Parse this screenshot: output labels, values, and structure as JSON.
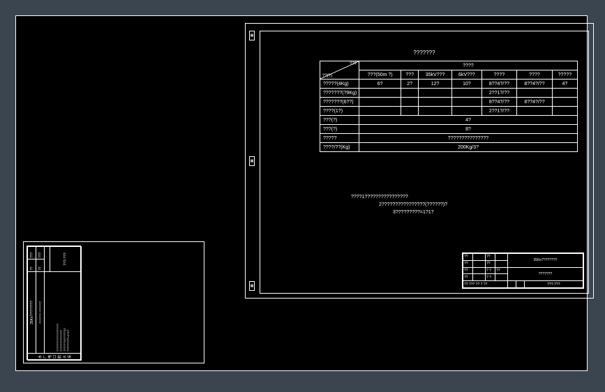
{
  "title_top": "???????",
  "diag_header": {
    "top": "???",
    "bottom": "??(?)"
  },
  "super_header": "????",
  "col_headers": [
    "???(50m ?)",
    "???",
    "35kV???",
    "6kV???",
    "????",
    "????",
    "?????"
  ],
  "rows": [
    {
      "label": "?????(4Kg)",
      "cells": [
        "6?",
        "2?",
        "12?",
        "10?",
        "8??4?/??",
        "8??4?/??",
        "4?"
      ]
    },
    {
      "label": "???????(?9Kg)",
      "cells": [
        "",
        "",
        "",
        "",
        "2??1?/??",
        "",
        ""
      ]
    },
    {
      "label": "???????(6??)",
      "cells": [
        "",
        "",
        "",
        "",
        "8??4?/??",
        "8??4?/??",
        ""
      ]
    },
    {
      "label": "????(1?)",
      "cells": [
        "",
        "",
        "",
        "",
        "2??1?/??",
        "",
        ""
      ]
    }
  ],
  "merged_rows": [
    {
      "label": "???(?)",
      "value": "4?"
    },
    {
      "label": "???(?)",
      "value": "8?"
    },
    {
      "label": "?????",
      "value": "???????????????"
    },
    {
      "label": "????/??(Kg)",
      "value": "200Kg/3?"
    }
  ],
  "notes": {
    "n1": "????1????????????????",
    "n2": "2????????????????(??????)?",
    "n3": "3?????????=1?1?"
  },
  "title_block": {
    "org": "35Kn????????",
    "sub": "???????",
    "r1c1": "??",
    "r1c2": "??",
    "r1c3": "??",
    "r2c1": "??",
    "r2c2": "??",
    "r3c1": "??",
    "r3c2": "? ?",
    "r3c3": "??",
    "scale": "??",
    "sheet": "? ?",
    "bottom": "?? ??? ?? ? ??",
    "num": "???-???"
  },
  "small_block": {
    "title": "水厂电口防火设",
    "org": "35Kn????????",
    "sub": "??????? ???????",
    "b1": "??",
    "b2": "??",
    "b3": "???-???",
    "rows": [
      "??????????????????",
      "??????????????",
      "???????(??????)?",
      "?????????=1?1?"
    ],
    "r1": "???",
    "r2": "???"
  }
}
